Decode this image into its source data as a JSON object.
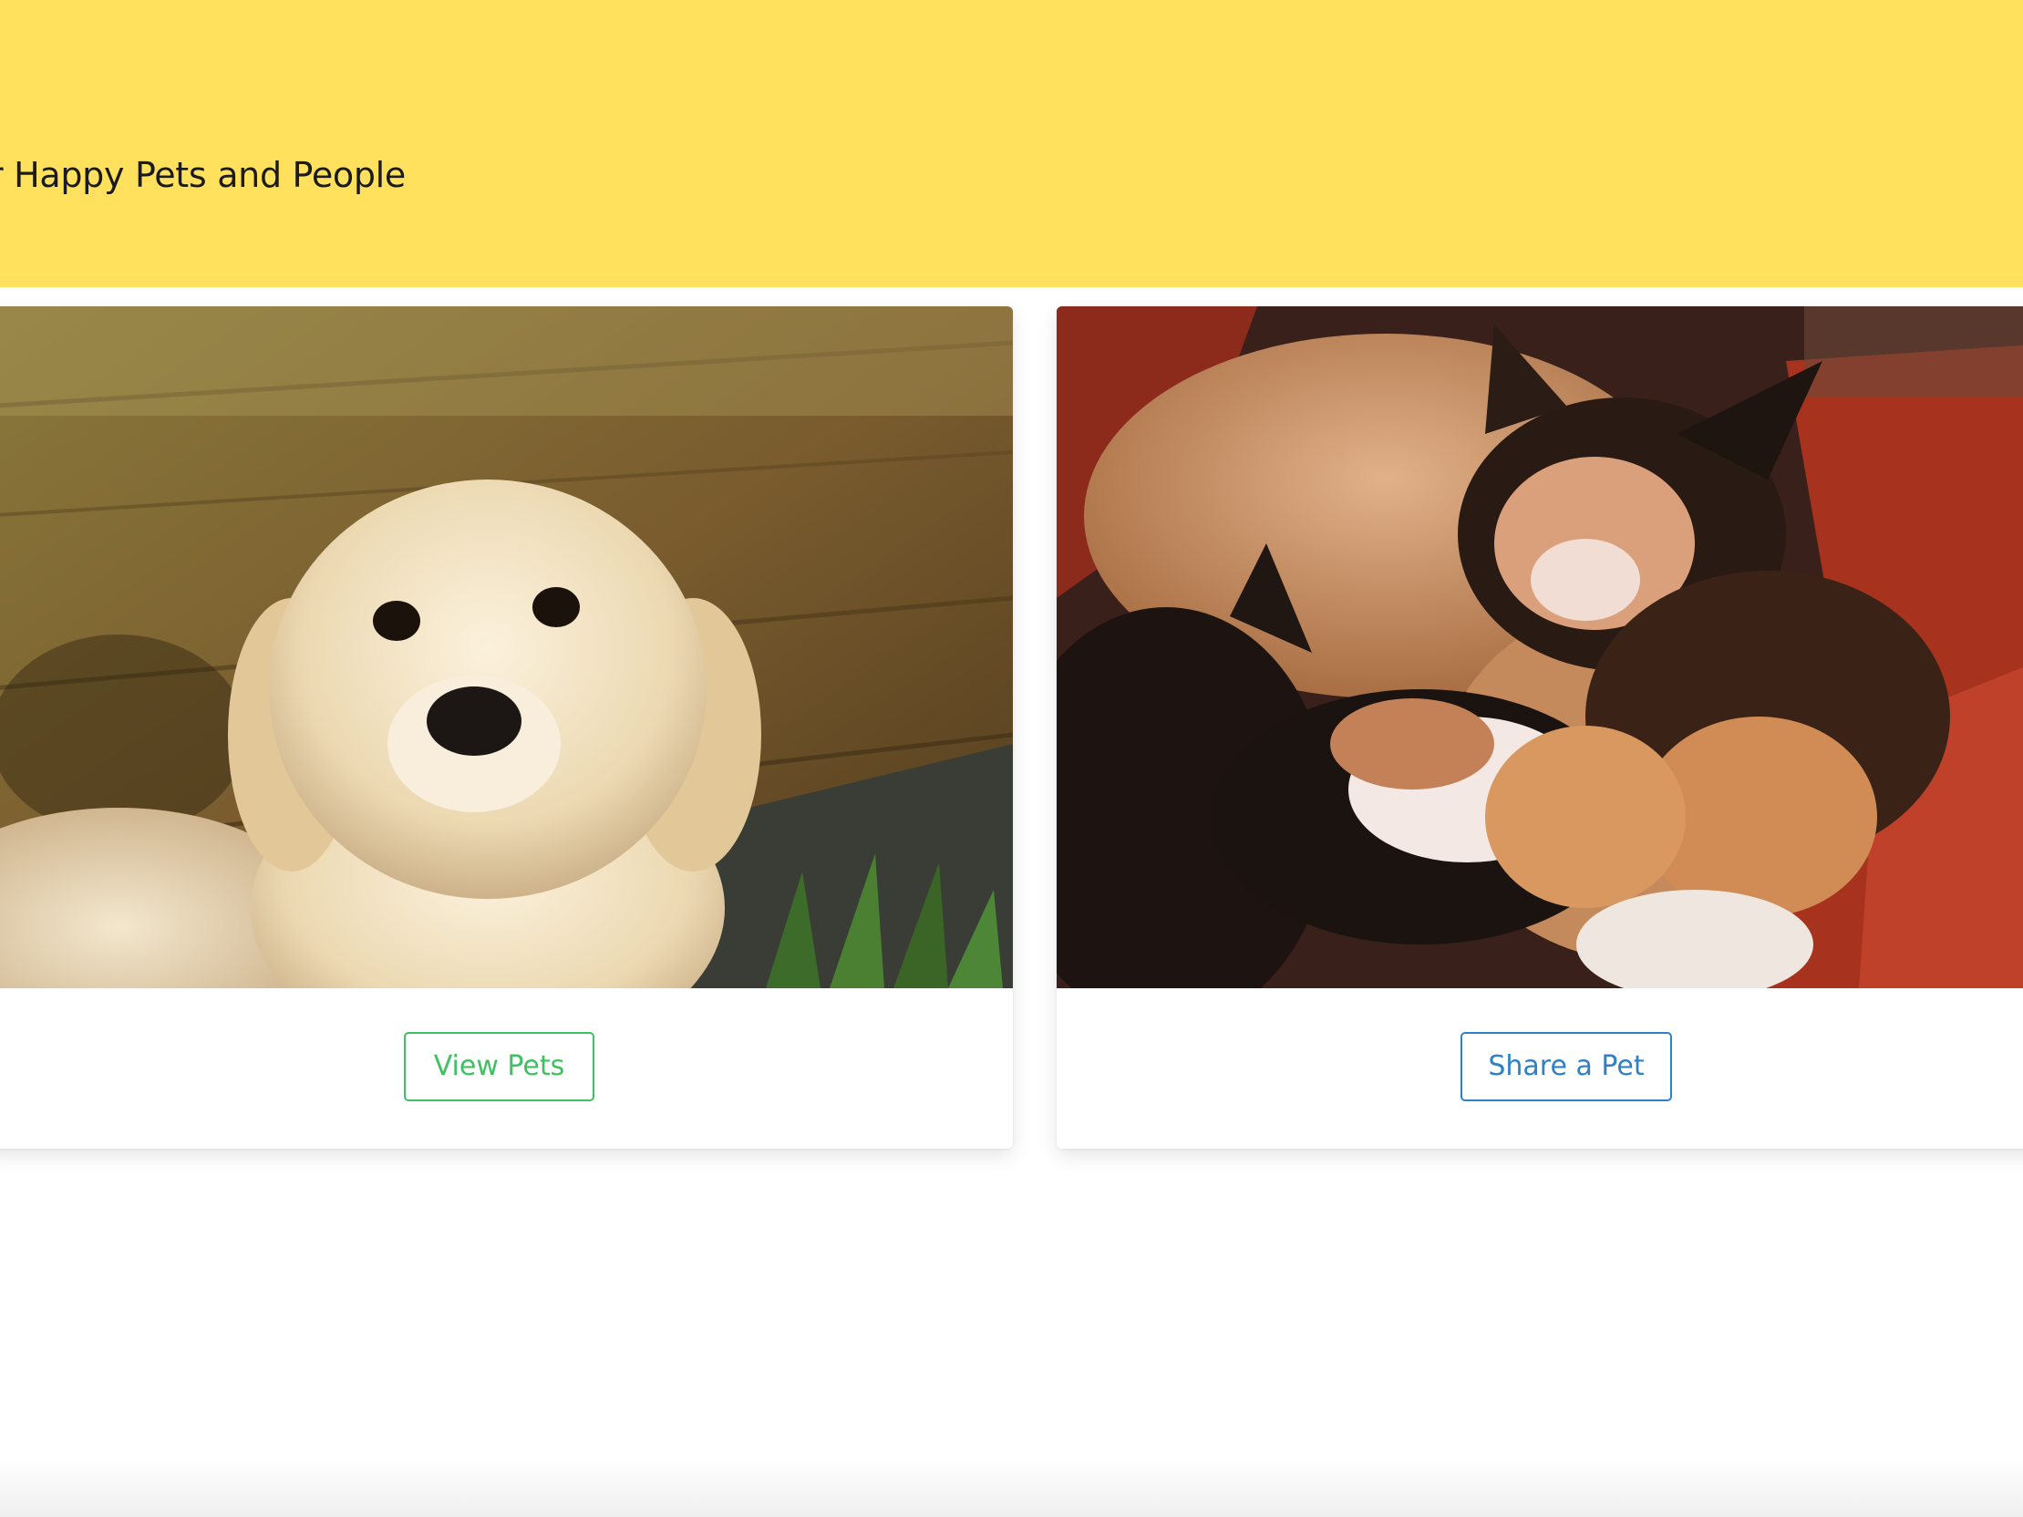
{
  "hero": {
    "subtitle": "r Happy Pets and People",
    "background_color": "#ffe15d"
  },
  "cards": [
    {
      "image": "golden-retriever-puppy-photo",
      "button_label": "View Pets",
      "button_color": "#3fc162"
    },
    {
      "image": "sleeping-kittens-photo",
      "button_label": "Share a Pet",
      "button_color": "#2f80c8"
    }
  ]
}
